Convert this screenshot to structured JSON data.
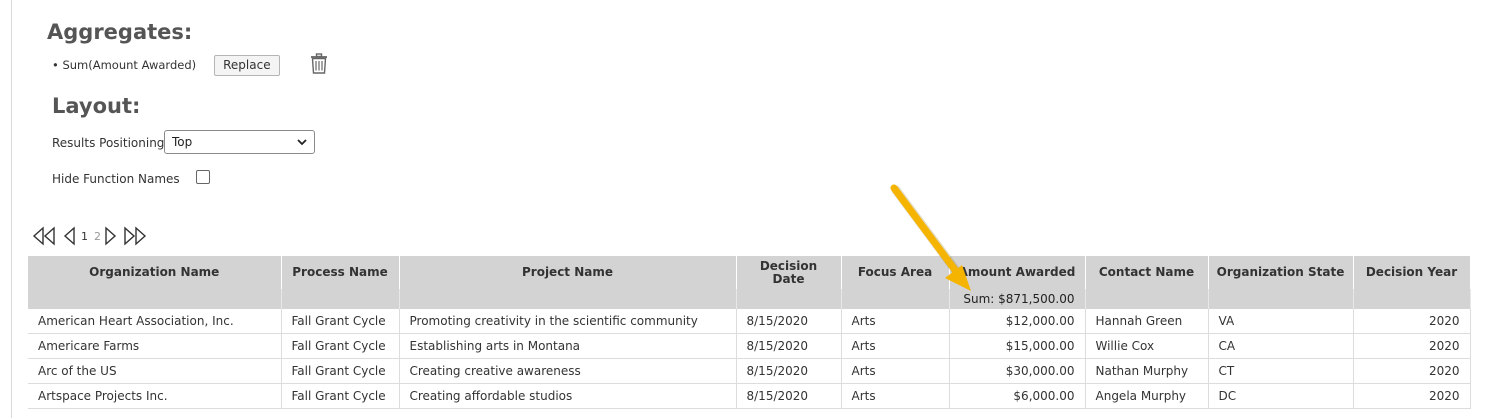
{
  "aggregates": {
    "heading": "Aggregates:",
    "item": "• Sum(Amount Awarded)",
    "replace_label": "Replace"
  },
  "layout": {
    "heading": "Layout:",
    "results_positioning_label": "Results Positioning",
    "results_positioning_value": "Top",
    "hide_function_names_label": "Hide Function Names",
    "hide_function_names_checked": false
  },
  "pager": {
    "current_page": "1",
    "other_page": "2"
  },
  "colors": {
    "header_bg": "#d3d3d3",
    "arrow": "#f5b400"
  },
  "table": {
    "columns": [
      "Organization Name",
      "Process Name",
      "Project Name",
      "Decision Date",
      "Focus Area",
      "Amount Awarded",
      "Contact Name",
      "Organization State",
      "Decision Year"
    ],
    "aggregate_row": {
      "amount_awarded": "Sum: $871,500.00"
    },
    "rows": [
      [
        "American Heart Association, Inc.",
        "Fall Grant Cycle",
        "Promoting creativity in the scientific community",
        "8/15/2020",
        "Arts",
        "$12,000.00",
        "Hannah Green",
        "VA",
        "2020"
      ],
      [
        "Americare Farms",
        "Fall Grant Cycle",
        "Establishing arts in Montana",
        "8/15/2020",
        "Arts",
        "$15,000.00",
        "Willie Cox",
        "CA",
        "2020"
      ],
      [
        "Arc of the US",
        "Fall Grant Cycle",
        "Creating creative awareness",
        "8/15/2020",
        "Arts",
        "$30,000.00",
        "Nathan Murphy",
        "CT",
        "2020"
      ],
      [
        "Artspace Projects Inc.",
        "Fall Grant Cycle",
        "Creating affordable studios",
        "8/15/2020",
        "Arts",
        "$6,000.00",
        "Angela Murphy",
        "DC",
        "2020"
      ]
    ]
  }
}
